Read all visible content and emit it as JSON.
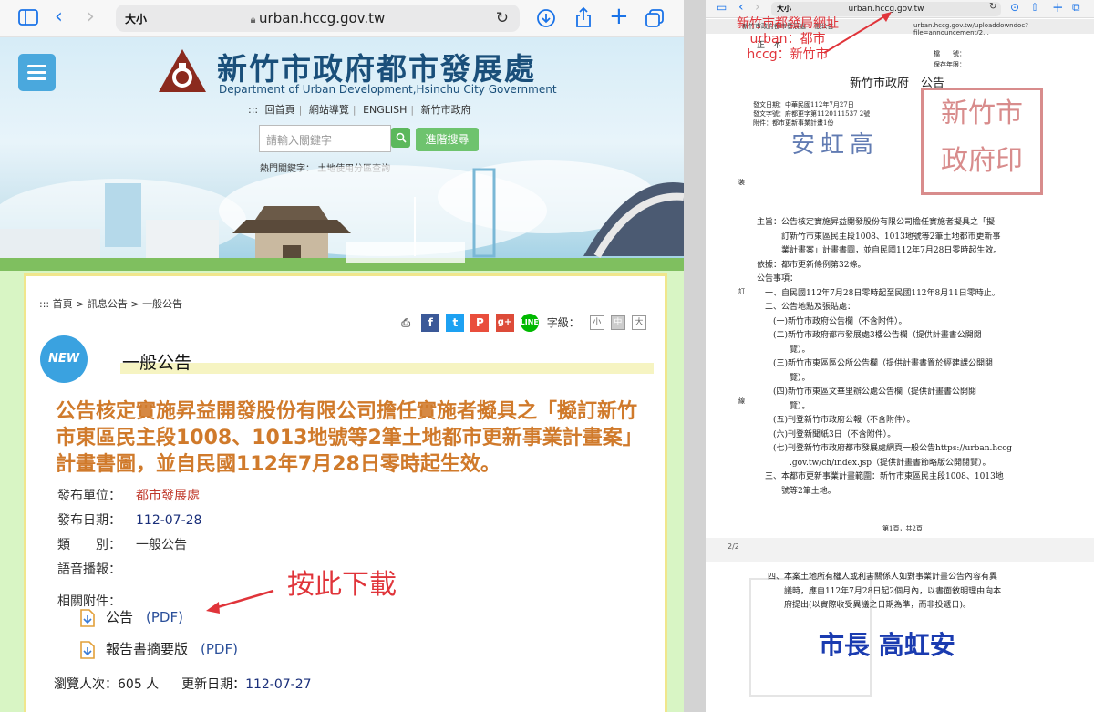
{
  "left_browser": {
    "text_size_label": "大小",
    "url": "urban.hccg.gov.tw"
  },
  "site": {
    "org_title": "新竹市政府都市發展處",
    "org_subtitle": "Department of Urban Development,Hsinchu City Government",
    "top_nav": [
      ":::",
      "回首頁",
      "網站導覽",
      "ENGLISH",
      "新竹市政府"
    ],
    "search_placeholder": "請輸入關鍵字",
    "advanced_search_label": "進階搜尋",
    "hot_keywords_label": "熱門關鍵字：",
    "hot_keyword": "土地使用分區查詢"
  },
  "breadcrumb": [
    ":::",
    "首頁",
    "訊息公告",
    "一般公告"
  ],
  "toolbar": {
    "font_size_label": "字級：",
    "font_sizes": [
      "小",
      "中",
      "大"
    ]
  },
  "new_badge": "NEW",
  "section_title": "一般公告",
  "headline": "公告核定實施昇益開發股份有限公司擔任實施者擬具之「擬訂新竹市東區民主段1008、1013地號等2筆土地都市更新事業計畫案」計畫書圖，並自民國112年7月28日零時起生效。",
  "meta": {
    "publisher_label": "發布單位：",
    "publisher": "都市發展處",
    "date_label": "發布日期：",
    "date": "112-07-28",
    "category_label": "類　　別：",
    "category": "一般公告",
    "voice_label": "語音播報：",
    "attachments_label": "相關附件："
  },
  "attachments": [
    {
      "name": "公告",
      "type": "(PDF)"
    },
    {
      "name": "報告書摘要版",
      "type": "(PDF)"
    }
  ],
  "footer": {
    "views_label": "瀏覽人次：",
    "views": "605 人",
    "updated_label": "更新日期：",
    "updated": "112-07-27"
  },
  "annotation_left": "按此下載",
  "right_browser": {
    "text_size_label": "大小",
    "url": "urban.hccg.gov.tw",
    "tab1": "新竹市政府都市發展處-一般公告",
    "tab2": "urban.hccg.gov.tw/uploaddowndoc?file=announcement/2..."
  },
  "annotation_right": [
    "新竹市都發局網址",
    "urban：都市",
    "hccg：新竹市"
  ],
  "document": {
    "copy_label": "正　本",
    "file_no_label": "檔　　號：",
    "retention_label": "保存年限：",
    "gov_title": "新竹市政府　公告",
    "issue_date": "發文日期：中華民國112年7月27日",
    "issue_no": "發文字號：府都更字第1120111537 2號",
    "attachment": "附件：都市更新事業計畫1份",
    "signature": "安虹高",
    "binding_marks": [
      "裝",
      "訂",
      "線"
    ],
    "subject": [
      "主旨：公告核定實施昇益開發股份有限公司擔任實施者擬具之「擬",
      "　　　訂新竹市東區民主段1008、1013地號等2筆土地都市更新事",
      "　　　業計畫案」計畫書圖，並自民國112年7月28日零時起生效。"
    ],
    "basis": "依據：都市更新條例第32條。",
    "items_label": "公告事項：",
    "items": [
      "　一、自民國112年7月28日零時起至民國112年8月11日零時止。",
      "　二、公告地點及張貼處：",
      "　　(一)新竹市政府公告欄（不含附件）。",
      "　　(二)新竹市政府都市發展處3樓公告欄（提供計畫書公開閱",
      "　　　　覽）。",
      "　　(三)新竹市東區區公所公告欄（提供計畫書置於經建課公開閱",
      "　　　　覽）。",
      "　　(四)新竹市東區文華里辦公處公告欄（提供計畫書公開閱",
      "　　　　覽）。",
      "　　(五)刊登新竹市政府公報（不含附件）。",
      "　　(六)刊登新聞紙3日（不含附件）。",
      "　　(七)刊登新竹市政府都市發展處網頁一般公告https://urban.hccg",
      "　　　　.gov.tw/ch/index.jsp（提供計畫書節略版公開閱覽）。",
      "　三、本都市更新事業計畫範圍：新竹市東區民主段1008、1013地",
      "　　　號等2筆土地。"
    ],
    "page_label": "第1頁，共2頁",
    "page_indicator": "2/2",
    "page2": [
      "四、本案土地所有權人或利害關係人如對事業計畫公告內容有異",
      "　　議時，應自112年7月28日起2個月內，以書面敘明理由向本",
      "　　府提出(以實際收受異議之日期為準，而非投遞日)。"
    ],
    "mayor_signature": "市長 高虹安"
  }
}
